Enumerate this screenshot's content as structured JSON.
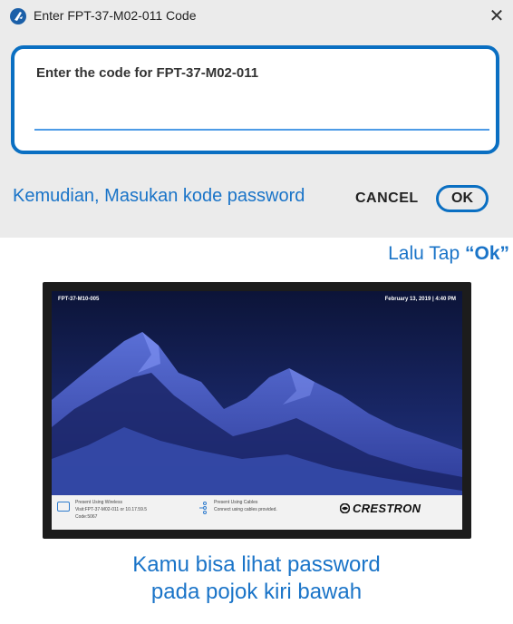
{
  "dialog": {
    "title": "Enter FPT-37-M02-011 Code",
    "close_symbol": "✕",
    "prompt": "Enter the code for FPT-37-M02-011",
    "input_value": "",
    "cancel_label": "CANCEL",
    "ok_label": "OK"
  },
  "annotations": {
    "instruction_1": "Kemudian, Masukan kode password",
    "instruction_2_prefix": "Lalu Tap ",
    "instruction_2_emphasis": "“Ok”",
    "caption_line_1": "Kamu bisa lihat password",
    "caption_line_2": "pada pojok kiri bawah"
  },
  "tv_screen": {
    "room_name": "FPT-37-M10-005",
    "date_time": "February 13, 2019 | 4:40 PM",
    "wireless_heading": "Present Using Wireless",
    "wireless_visit": "Visit:FPT-37-M02-011 or 10.17.59.5",
    "wireless_code": "Code:5067",
    "cables_heading": "Present Using Cables",
    "cables_note": "Connect using cables provided.",
    "brand": "CRESTRON"
  },
  "colors": {
    "accent_blue": "#0a6fc2",
    "annotation_blue": "#1a74c8",
    "dialog_bg": "#ebebeb"
  },
  "icons": [
    "app-icon",
    "close-icon",
    "wireless-icon",
    "cable-icon",
    "crestron-logo-icon"
  ]
}
